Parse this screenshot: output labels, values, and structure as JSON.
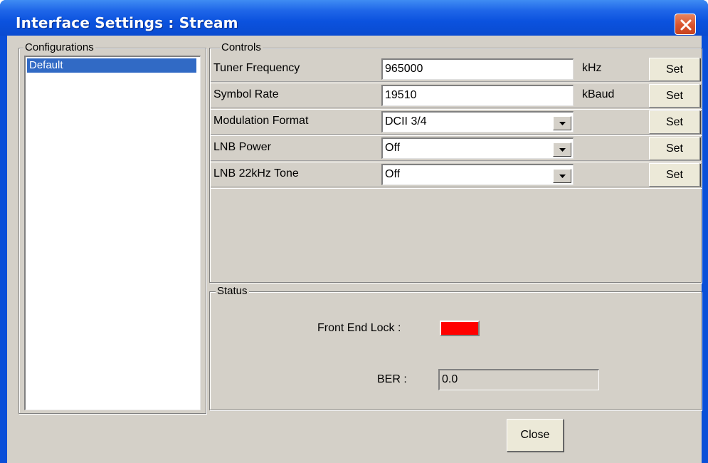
{
  "window": {
    "title": "Interface Settings : Stream"
  },
  "configurations": {
    "legend": "Configurations",
    "items": [
      {
        "label": "Default",
        "selected": true
      }
    ]
  },
  "controls": {
    "legend": "Controls",
    "rows": [
      {
        "label": "Tuner Frequency",
        "type": "text",
        "value": "965000",
        "unit": "kHz",
        "button": "Set"
      },
      {
        "label": "Symbol Rate",
        "type": "text",
        "value": "19510",
        "unit": "kBaud",
        "button": "Set"
      },
      {
        "label": "Modulation Format",
        "type": "combo",
        "value": "DCII 3/4",
        "unit": "",
        "button": "Set"
      },
      {
        "label": "LNB Power",
        "type": "combo",
        "value": "Off",
        "unit": "",
        "button": "Set"
      },
      {
        "label": "LNB 22kHz Tone",
        "type": "combo",
        "value": "Off",
        "unit": "",
        "button": "Set"
      }
    ]
  },
  "status": {
    "legend": "Status",
    "front_end_lock_label": "Front End Lock :",
    "front_end_lock_color": "#ff0000",
    "ber_label": "BER :",
    "ber_value": "0.0"
  },
  "footer": {
    "close_label": "Close"
  },
  "colors": {
    "titlebar": "#0a4fd8",
    "selection": "#316ac5",
    "dialog_bg": "#d4d0c8",
    "close_button": "#d9532d"
  },
  "icons": {
    "close": "close-x-icon",
    "dropdown": "chevron-down-icon"
  }
}
